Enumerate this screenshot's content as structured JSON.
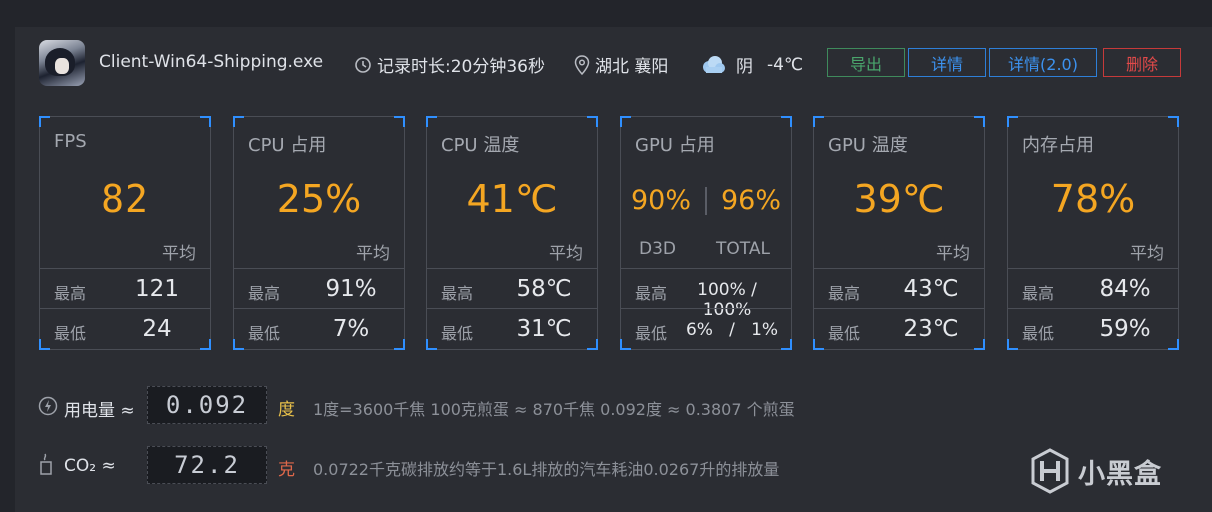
{
  "header": {
    "process_name": "Client-Win64-Shipping.exe",
    "duration": "记录时长:20分钟36秒",
    "location": "湖北 襄阳",
    "weather": "阴",
    "temperature": "-4℃",
    "buttons": {
      "export": "导出",
      "detail": "详情",
      "detail2": "详情(2.0)",
      "delete": "删除"
    },
    "colors": {
      "export": "#4aa56c",
      "detail": "#3c92ef",
      "delete": "#e24a4a"
    }
  },
  "cards": {
    "fps": {
      "title": "FPS",
      "value": "82",
      "avg": "平均",
      "max_label": "最高",
      "max": "121",
      "min_label": "最低",
      "min": "24"
    },
    "cpu_usage": {
      "title": "CPU 占用",
      "value": "25%",
      "avg": "平均",
      "max_label": "最高",
      "max": "91%",
      "min_label": "最低",
      "min": "7%"
    },
    "cpu_temp": {
      "title": "CPU 温度",
      "value": "41℃",
      "avg": "平均",
      "max_label": "最高",
      "max": "58℃",
      "min_label": "最低",
      "min": "31℃"
    },
    "gpu_usage": {
      "title": "GPU 占用",
      "d3d_value": "90%",
      "total_value": "96%",
      "d3d_label": "D3D",
      "total_label": "TOTAL",
      "max_label": "最高",
      "max": "100% / 100%",
      "min_label": "最低",
      "min": "6%   /   1%"
    },
    "gpu_temp": {
      "title": "GPU 温度",
      "value": "39℃",
      "avg": "平均",
      "max_label": "最高",
      "max": "43℃",
      "min_label": "最低",
      "min": "23℃"
    },
    "memory": {
      "title": "内存占用",
      "value": "78%",
      "avg": "平均",
      "max_label": "最高",
      "max": "84%",
      "min_label": "最低",
      "min": "59%"
    }
  },
  "power": {
    "label": "用电量 ≈",
    "value": "0.092",
    "unit": "度",
    "note": "1度=3600千焦    100克煎蛋 ≈ 870千焦    0.092度 ≈ 0.3807 个煎蛋"
  },
  "co2": {
    "label": "CO₂ ≈",
    "value": "72.2",
    "unit": "克",
    "note": "0.0722千克碳排放约等于1.6L排放的汽车耗油0.0267升的排放量"
  },
  "watermark": "小黑盒",
  "accent_color": "#f4a622"
}
